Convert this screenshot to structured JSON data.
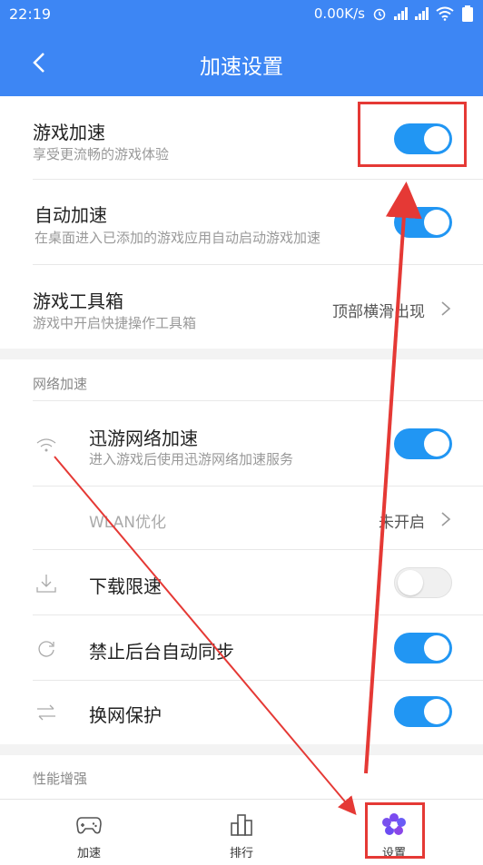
{
  "status_bar": {
    "time": "22:19",
    "network_speed": "0.00K/s"
  },
  "header": {
    "title": "加速设置"
  },
  "items": {
    "game_accel": {
      "title": "游戏加速",
      "sub": "享受更流畅的游戏体验",
      "on": true
    },
    "auto_accel": {
      "title": "自动加速",
      "sub": "在桌面进入已添加的游戏应用自动启动游戏加速",
      "on": true
    },
    "toolbox": {
      "title": "游戏工具箱",
      "sub": "游戏中开启快捷操作工具箱",
      "value": "顶部横滑出现"
    }
  },
  "network_section": {
    "label": "网络加速",
    "xunyou": {
      "title": "迅游网络加速",
      "sub": "进入游戏后使用迅游网络加速服务",
      "on": true
    },
    "wlan": {
      "title": "WLAN优化",
      "value": "未开启"
    },
    "download_limit": {
      "title": "下载限速",
      "on": false
    },
    "bg_sync": {
      "title": "禁止后台自动同步",
      "on": true
    },
    "net_protect": {
      "title": "换网保护",
      "on": true
    }
  },
  "performance_section": {
    "label": "性能增强"
  },
  "bottom_nav": [
    {
      "label": "加速",
      "icon": "gamepad-icon"
    },
    {
      "label": "排行",
      "icon": "ranking-icon"
    },
    {
      "label": "设置",
      "icon": "settings-flower-icon"
    }
  ],
  "colors": {
    "primary": "#3d86f4",
    "toggle_on": "#2196f3",
    "annotation": "#e53935"
  }
}
